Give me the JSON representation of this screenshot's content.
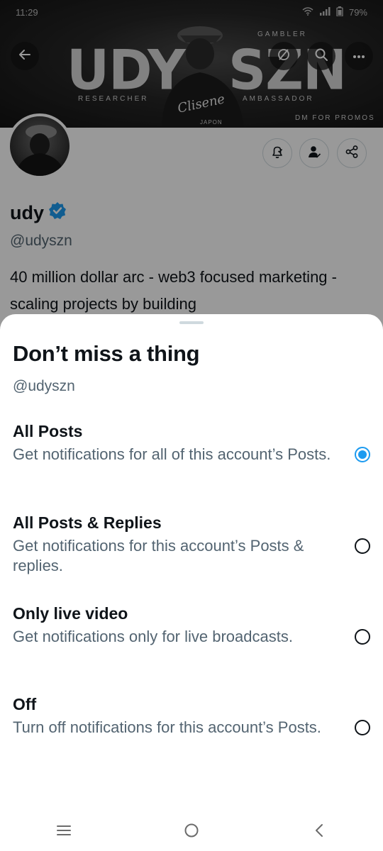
{
  "status_bar": {
    "time": "11:29",
    "battery": "79%"
  },
  "banner": {
    "left_text": "UDY",
    "right_text": "SZN",
    "top_right_caption": "GAMBLER",
    "left_caption": "RESEARCHER",
    "right_caption": "AMBASSADOR",
    "promo_caption": "DM FOR PROMOS",
    "brand_script": "Clisene",
    "brand_sub": "JAPON"
  },
  "profile": {
    "display_name": "udy",
    "handle": "@udyszn",
    "bio": "40 million dollar arc - web3 focused marketing - scaling projects by building"
  },
  "sheet": {
    "title": "Don’t miss a thing",
    "subtitle": "@udyszn",
    "options": [
      {
        "title": "All Posts",
        "description": "Get notifications for all of this account’s Posts.",
        "selected": true
      },
      {
        "title": "All Posts & Replies",
        "description": "Get notifications for this account’s Posts & replies.",
        "selected": false
      },
      {
        "title": "Only live video",
        "description": "Get notifications only for live broadcasts.",
        "selected": false
      },
      {
        "title": "Off",
        "description": "Turn off notifications for this account’s Posts.",
        "selected": false
      }
    ]
  },
  "colors": {
    "accent": "#1d9bf0",
    "text_primary": "#0f1419",
    "text_secondary": "#536471"
  }
}
